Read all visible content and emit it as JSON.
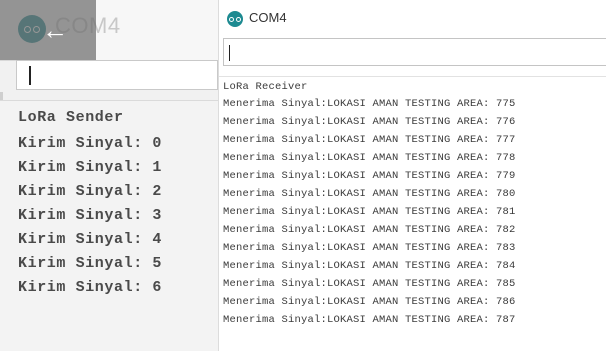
{
  "sender_window": {
    "title": "COM4",
    "logo_icon": "arduino-logo-icon",
    "back_icon": "back-arrow-icon",
    "input_value": "",
    "monitor_lines": [
      "LoRa Sender",
      "Kirim Sinyal: 0",
      "Kirim Sinyal: 1",
      "Kirim Sinyal: 2",
      "Kirim Sinyal: 3",
      "Kirim Sinyal: 4",
      "Kirim Sinyal: 5",
      "Kirim Sinyal: 6"
    ]
  },
  "receiver_window": {
    "title": "COM4",
    "logo_icon": "arduino-logo-icon",
    "input_value": "",
    "monitor_lines": [
      "LoRa Receiver",
      "Menerima Sinyal:LOKASI AMAN TESTING AREA: 775",
      "Menerima Sinyal:LOKASI AMAN TESTING AREA: 776",
      "Menerima Sinyal:LOKASI AMAN TESTING AREA: 777",
      "Menerima Sinyal:LOKASI AMAN TESTING AREA: 778",
      "Menerima Sinyal:LOKASI AMAN TESTING AREA: 779",
      "Menerima Sinyal:LOKASI AMAN TESTING AREA: 780",
      "Menerima Sinyal:LOKASI AMAN TESTING AREA: 781",
      "Menerima Sinyal:LOKASI AMAN TESTING AREA: 782",
      "Menerima Sinyal:LOKASI AMAN TESTING AREA: 783",
      "Menerima Sinyal:LOKASI AMAN TESTING AREA: 784",
      "Menerima Sinyal:LOKASI AMAN TESTING AREA: 785",
      "Menerima Sinyal:LOKASI AMAN TESTING AREA: 786",
      "Menerima Sinyal:LOKASI AMAN TESTING AREA: 787"
    ]
  },
  "colors": {
    "arduino_teal": "#1d8a91"
  }
}
